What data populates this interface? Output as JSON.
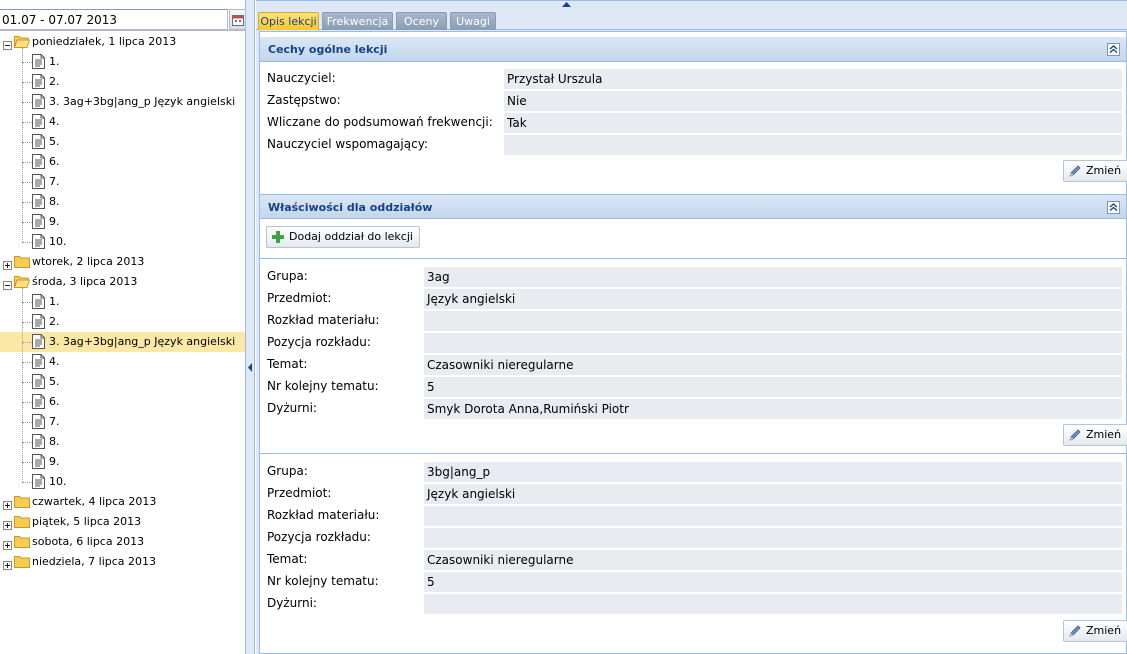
{
  "date_range": "01.07 - 07.07 2013",
  "tree": [
    {
      "label": "poniedziałek, 1 lipca 2013",
      "expanded": true,
      "children": [
        {
          "label": "1."
        },
        {
          "label": "2."
        },
        {
          "label": "3. 3ag+3bg|ang_p Język angielski"
        },
        {
          "label": "4."
        },
        {
          "label": "5."
        },
        {
          "label": "6."
        },
        {
          "label": "7."
        },
        {
          "label": "8."
        },
        {
          "label": "9."
        },
        {
          "label": "10."
        }
      ]
    },
    {
      "label": "wtorek, 2 lipca 2013",
      "expanded": false,
      "children": []
    },
    {
      "label": "środa, 3 lipca 2013",
      "expanded": true,
      "children": [
        {
          "label": "1."
        },
        {
          "label": "2."
        },
        {
          "label": "3. 3ag+3bg|ang_p Język angielski",
          "selected": true
        },
        {
          "label": "4."
        },
        {
          "label": "5."
        },
        {
          "label": "6."
        },
        {
          "label": "7."
        },
        {
          "label": "8."
        },
        {
          "label": "9."
        },
        {
          "label": "10."
        }
      ]
    },
    {
      "label": "czwartek, 4 lipca 2013",
      "expanded": false,
      "children": []
    },
    {
      "label": "piątek, 5 lipca 2013",
      "expanded": false,
      "children": []
    },
    {
      "label": "sobota, 6 lipca 2013",
      "expanded": false,
      "children": []
    },
    {
      "label": "niedziela, 7 lipca 2013",
      "expanded": false,
      "children": []
    }
  ],
  "tabs": [
    {
      "label": "Opis lekcji",
      "active": true
    },
    {
      "label": "Frekwencja",
      "active": false
    },
    {
      "label": "Oceny",
      "active": false
    },
    {
      "label": "Uwagi",
      "active": false
    }
  ],
  "general": {
    "title": "Cechy ogólne lekcji",
    "fields": [
      {
        "label": "Nauczyciel:",
        "value": "Przystał Urszula"
      },
      {
        "label": "Zastępstwo:",
        "value": "Nie"
      },
      {
        "label": "Wliczane do podsumowań frekwencji:",
        "value": "Tak"
      },
      {
        "label": "Nauczyciel wspomagający:",
        "value": ""
      }
    ],
    "edit_label": "Zmień"
  },
  "divisions": {
    "title": "Właściwości dla oddziałów",
    "add_label": "Dodaj oddział do lekcji",
    "groups": [
      {
        "fields": [
          {
            "label": "Grupa:",
            "value": "3ag"
          },
          {
            "label": "Przedmiot:",
            "value": "Język angielski"
          },
          {
            "label": "Rozkład materiału:",
            "value": ""
          },
          {
            "label": "Pozycja rozkładu:",
            "value": ""
          },
          {
            "label": "Temat:",
            "value": "Czasowniki nieregularne"
          },
          {
            "label": "Nr kolejny tematu:",
            "value": "5"
          },
          {
            "label": "Dyżurni:",
            "value": "Smyk Dorota Anna,Rumiński Piotr"
          }
        ],
        "edit_label": "Zmień"
      },
      {
        "fields": [
          {
            "label": "Grupa:",
            "value": "3bg|ang_p"
          },
          {
            "label": "Przedmiot:",
            "value": "Język angielski"
          },
          {
            "label": "Rozkład materiału:",
            "value": ""
          },
          {
            "label": "Pozycja rozkładu:",
            "value": ""
          },
          {
            "label": "Temat:",
            "value": "Czasowniki nieregularne"
          },
          {
            "label": "Nr kolejny tematu:",
            "value": "5"
          },
          {
            "label": "Dyżurni:",
            "value": ""
          }
        ],
        "edit_label": "Zmień"
      }
    ]
  },
  "colors": {
    "accent": "#f7c829",
    "selected_row": "#fbe7a6",
    "panel_header": "#15428b",
    "field_bg": "#e8ecf1"
  }
}
